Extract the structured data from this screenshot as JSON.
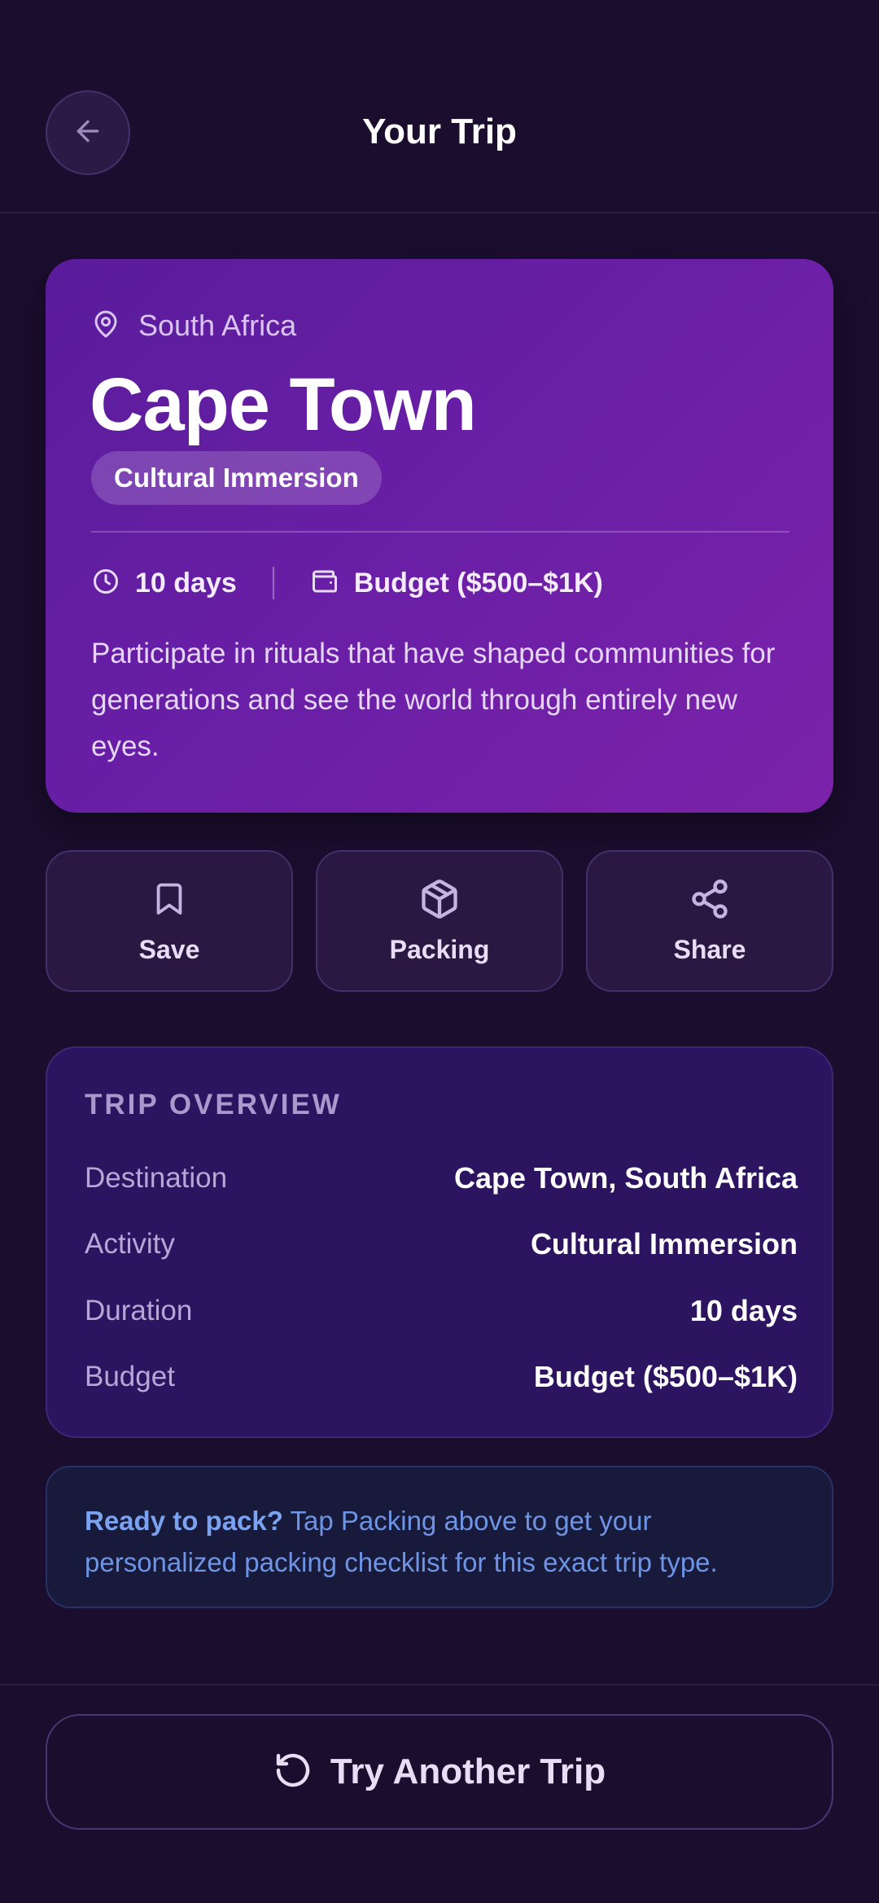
{
  "header": {
    "title": "Your Trip",
    "back_icon": "arrow-left-icon"
  },
  "hero": {
    "country": "South Africa",
    "city": "Cape Town",
    "tag": "Cultural Immersion",
    "duration": "10 days",
    "budget": "Budget ($500–$1K)",
    "description": "Participate in rituals that have shaped communities for generations and see the world through entirely new eyes.",
    "gradient_start": "#5a1c9c",
    "gradient_end": "#7b22aa"
  },
  "actions": [
    {
      "label": "Save",
      "icon": "bookmark-icon"
    },
    {
      "label": "Packing",
      "icon": "package-icon"
    },
    {
      "label": "Share",
      "icon": "share-icon"
    }
  ],
  "overview": {
    "title": "TRIP OVERVIEW",
    "rows": [
      {
        "label": "Destination",
        "value": "Cape Town, South Africa"
      },
      {
        "label": "Activity",
        "value": "Cultural Immersion"
      },
      {
        "label": "Duration",
        "value": "10 days"
      },
      {
        "label": "Budget",
        "value": "Budget ($500–$1K)"
      }
    ]
  },
  "tip": {
    "lead": "Ready to pack?",
    "text": " Tap Packing above to get your personalized packing checklist for this exact trip type."
  },
  "footer": {
    "button_label": "Try Another Trip",
    "button_icon": "rotate-ccw-icon"
  },
  "colors": {
    "background": "#1b0d2e",
    "card": "#2d1460",
    "tip_text": "#6e94e3"
  }
}
